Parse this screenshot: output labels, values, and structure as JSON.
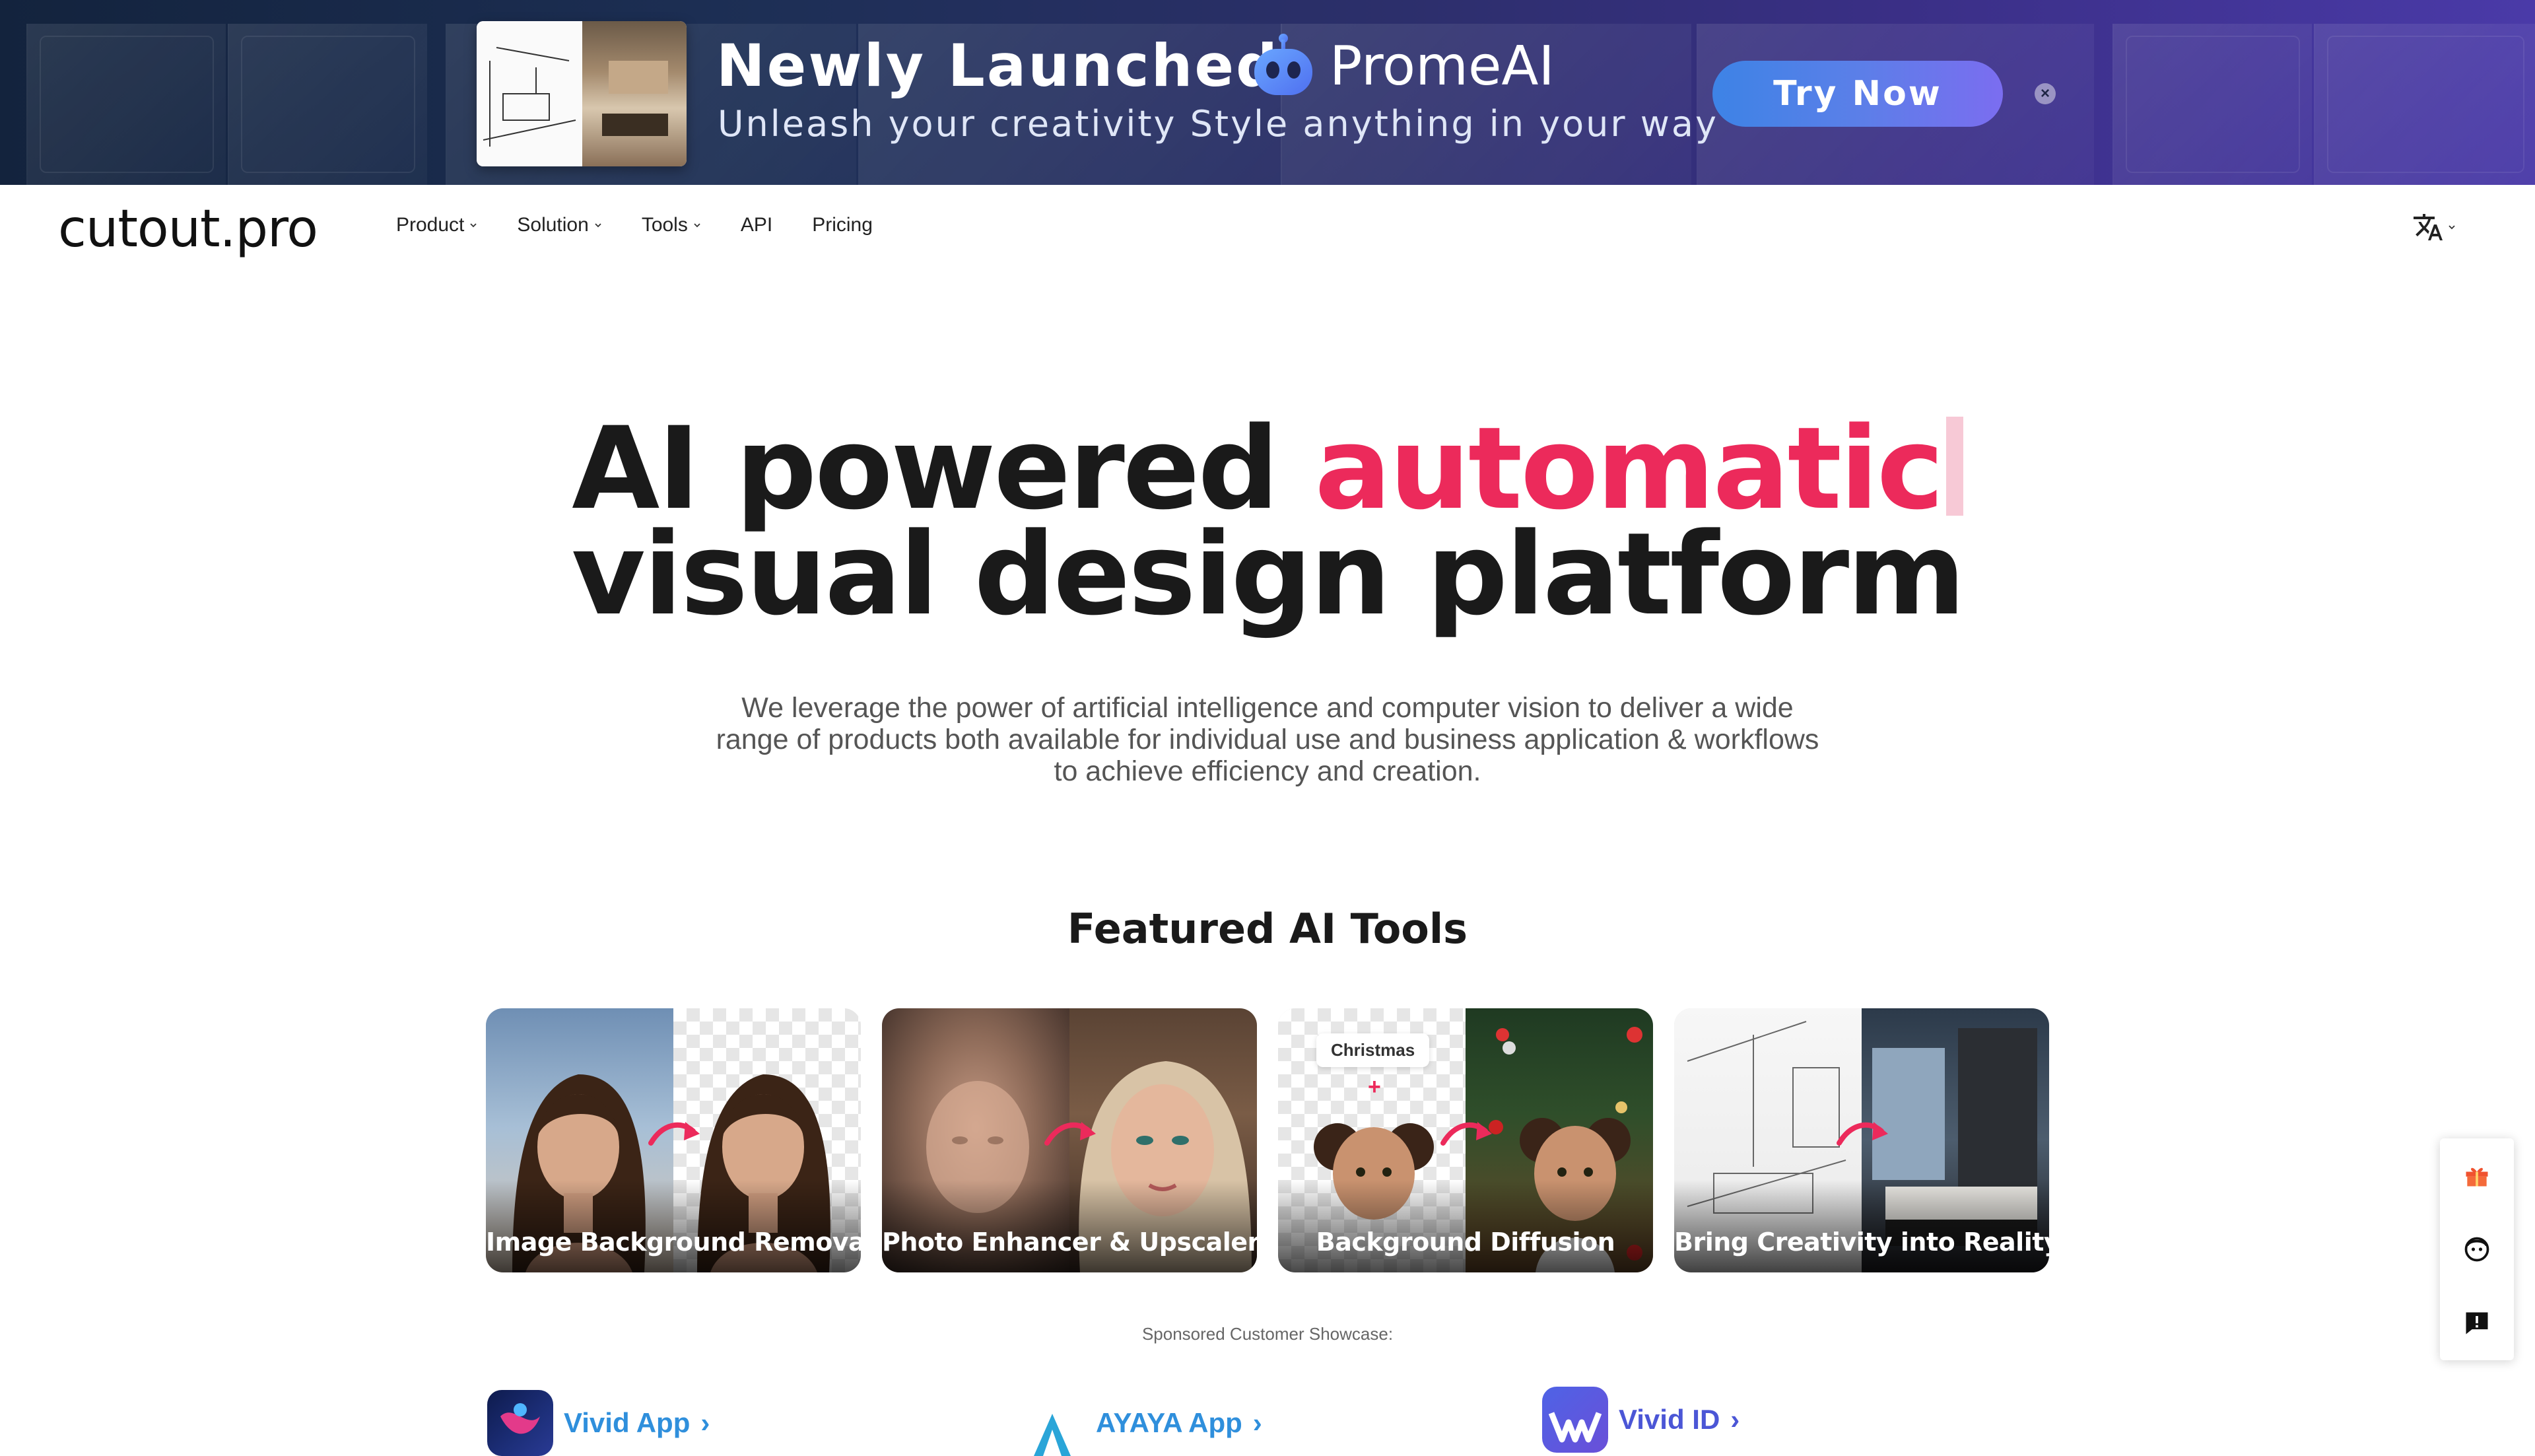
{
  "promo": {
    "title": "Newly Launched",
    "brand": "PromeAI",
    "subtitle": "Unleash your creativity Style anything in your way",
    "cta_label": "Try Now",
    "close_label": "×"
  },
  "nav": {
    "logo": "cutout.pro",
    "items": [
      {
        "label": "Product",
        "has_dropdown": true
      },
      {
        "label": "Solution",
        "has_dropdown": true
      },
      {
        "label": "Tools",
        "has_dropdown": true
      },
      {
        "label": "API",
        "has_dropdown": false
      },
      {
        "label": "Pricing",
        "has_dropdown": false
      }
    ],
    "language_icon": "translate-icon"
  },
  "hero": {
    "title_part1": "AI powered ",
    "title_accent": "automatic",
    "title_line2": "visual design platform",
    "subtitle": "We leverage the power of artificial intelligence and computer vision to deliver a wide range of products both available for individual use and business application & workflows to achieve efficiency and creation.",
    "accent_color": "#ec2a5b"
  },
  "featured": {
    "title": "Featured AI Tools",
    "cards": [
      {
        "label": "Image Background Removal"
      },
      {
        "label": "Photo Enhancer & Upscaler"
      },
      {
        "label": "Background Diffusion",
        "tag": "Christmas",
        "tag_plus": "+"
      },
      {
        "label": "Bring Creativity into Reality"
      }
    ]
  },
  "sponsored": {
    "label": "Sponsored Customer Showcase:",
    "apps": [
      {
        "name": "Vivid App",
        "arrow": "›",
        "color": "#2f8fdc"
      },
      {
        "name": "AYAYA App",
        "arrow": "›",
        "color": "#2f8fdc"
      },
      {
        "name": "Vivid ID",
        "arrow": "›",
        "color": "#4b56d6"
      }
    ]
  },
  "dock": {
    "items": [
      "gift-icon",
      "support-face-icon",
      "feedback-icon"
    ]
  }
}
